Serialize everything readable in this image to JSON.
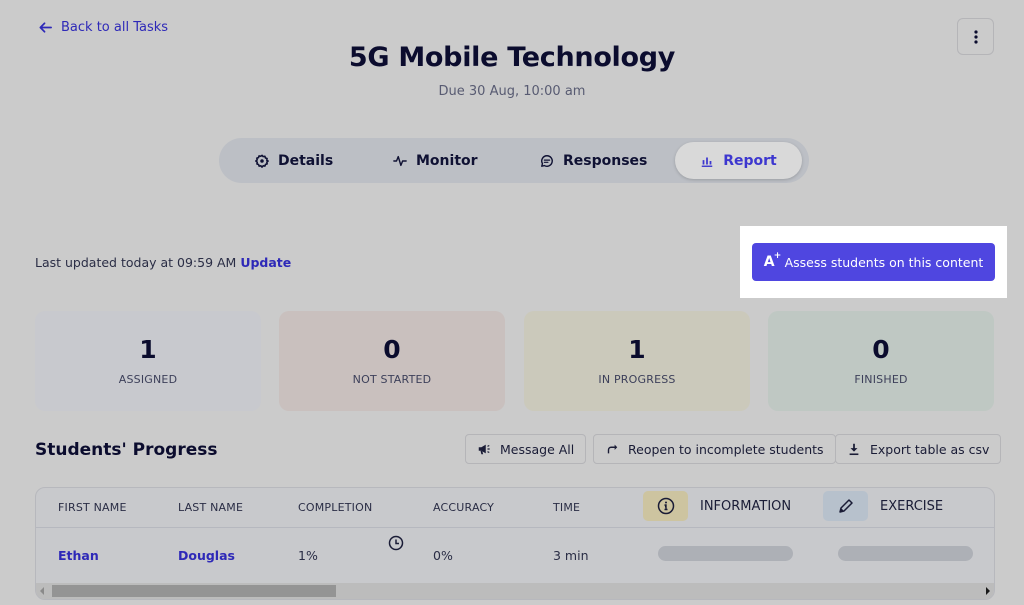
{
  "nav": {
    "back_label": "Back to all Tasks"
  },
  "header": {
    "title": "5G Mobile Technology",
    "due": "Due 30 Aug, 10:00 am"
  },
  "tabs": [
    {
      "label": "Details",
      "icon": "gear-icon",
      "active": false
    },
    {
      "label": "Monitor",
      "icon": "activity-icon",
      "active": false
    },
    {
      "label": "Responses",
      "icon": "chat-icon",
      "active": false
    },
    {
      "label": "Report",
      "icon": "bar-chart-icon",
      "active": true
    }
  ],
  "status": {
    "last_updated": "Last updated today at 09:59 AM",
    "update_link": "Update"
  },
  "assess_button": {
    "label": "Assess students on this content",
    "icon_text": "A",
    "icon_sup": "+"
  },
  "stats": [
    {
      "value": "1",
      "label": "ASSIGNED",
      "color": "#c8c9ce"
    },
    {
      "value": "0",
      "label": "NOT STARTED",
      "color": "#c9c0be"
    },
    {
      "value": "1",
      "label": "IN PROGRESS",
      "color": "#cbc9bb"
    },
    {
      "value": "0",
      "label": "FINISHED",
      "color": "#bfc8c3"
    }
  ],
  "progress": {
    "title": "Students' Progress",
    "actions": [
      {
        "label": "Message All",
        "icon": "megaphone-icon"
      },
      {
        "label": "Reopen to incomplete students",
        "icon": "redo-icon"
      },
      {
        "label": "Export table as csv",
        "icon": "download-icon"
      }
    ],
    "columns": [
      "FIRST NAME",
      "LAST NAME",
      "COMPLETION",
      "ACCURACY",
      "TIME"
    ],
    "content_columns": [
      {
        "label": "INFORMATION",
        "icon": "info-icon",
        "color": "#cdc4a0"
      },
      {
        "label": "EXERCISE",
        "icon": "pencil-icon",
        "color": "#b7c1cc"
      }
    ],
    "rows": [
      {
        "first_name": "Ethan",
        "last_name": "Douglas",
        "completion": "1%",
        "accuracy": "0%",
        "time": "3 min"
      }
    ]
  },
  "colors": {
    "accent": "#4f46e0",
    "link": "#2e29b8",
    "overlay_background": "#cbcbcb"
  }
}
